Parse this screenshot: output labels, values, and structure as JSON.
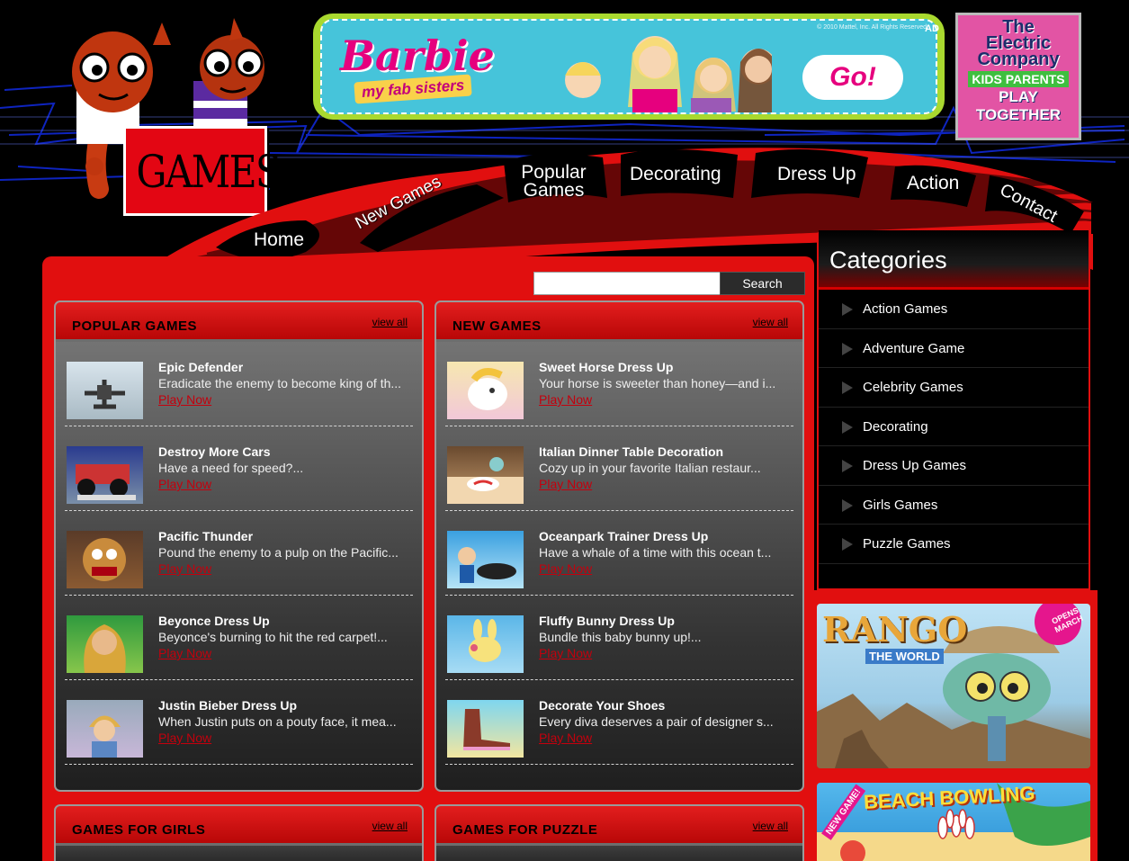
{
  "header": {
    "logo_text": "GAMES",
    "banner_ad": {
      "brand": "Barbie",
      "tagline": "my fab sisters",
      "copyright": "© 2010 Mattel, Inc. All Rights Reserved.",
      "button": "Go!",
      "ad_label": "AD"
    },
    "side_ad": {
      "line1": "The",
      "line2": "Electric",
      "line3": "Company",
      "line4": "KIDS PARENTS",
      "line5": "PLAY",
      "line6": "TOGETHER"
    }
  },
  "nav": {
    "items": [
      {
        "label": "Home"
      },
      {
        "label": "New Games"
      },
      {
        "label": "Popular Games"
      },
      {
        "label": "Decorating"
      },
      {
        "label": "Dress Up"
      },
      {
        "label": "Action"
      },
      {
        "label": "Contact"
      }
    ]
  },
  "search": {
    "button": "Search",
    "placeholder": ""
  },
  "panels": [
    {
      "title": "POPULAR GAMES",
      "view_all": "view all",
      "games": [
        {
          "title": "Epic Defender",
          "desc": "Eradicate the enemy to become king of th...",
          "play": "Play Now"
        },
        {
          "title": "Destroy More Cars",
          "desc": "Have a need for speed?...",
          "play": "Play Now"
        },
        {
          "title": "Pacific Thunder",
          "desc": "Pound the enemy to a pulp on the Pacific...",
          "play": "Play Now"
        },
        {
          "title": "Beyonce Dress Up",
          "desc": "Beyonce's burning to hit the red carpet!...",
          "play": "Play Now"
        },
        {
          "title": "Justin Bieber Dress Up",
          "desc": "When Justin puts on a pouty face, it mea...",
          "play": "Play Now"
        }
      ]
    },
    {
      "title": "NEW GAMES",
      "view_all": "view all",
      "games": [
        {
          "title": "Sweet Horse Dress Up",
          "desc": "Your horse is sweeter than honey—and i...",
          "play": "Play Now"
        },
        {
          "title": "Italian Dinner Table Decoration",
          "desc": "Cozy up in your favorite Italian restaur...",
          "play": "Play Now"
        },
        {
          "title": "Oceanpark Trainer Dress Up",
          "desc": "Have a whale of a time with this ocean t...",
          "play": "Play Now"
        },
        {
          "title": "Fluffy Bunny Dress Up",
          "desc": "Bundle this baby bunny up!...",
          "play": "Play Now"
        },
        {
          "title": "Decorate Your Shoes",
          "desc": "Every diva deserves a pair of designer s...",
          "play": "Play Now"
        }
      ]
    },
    {
      "title": "GAMES FOR GIRLS",
      "view_all": "view all"
    },
    {
      "title": "GAMES FOR PUZZLE",
      "view_all": "view all"
    }
  ],
  "sidebar": {
    "title": "Categories",
    "items": [
      {
        "label": "Action Games"
      },
      {
        "label": "Adventure Game"
      },
      {
        "label": "Celebrity Games"
      },
      {
        "label": "Decorating"
      },
      {
        "label": "Dress Up Games"
      },
      {
        "label": "Girls Games"
      },
      {
        "label": "Puzzle Games"
      }
    ],
    "ads": {
      "rango_title": "RANGO",
      "rango_sub": "THE WORLD",
      "rango_badge": "OPENS MARCH",
      "bowling_title": "BEACH BOWLING",
      "bowling_badge": "NEW GAME!"
    }
  },
  "colors": {
    "accent": "#e10f0f",
    "panel_head": "#d01010",
    "play_link": "#c4000d",
    "background": "#000000"
  }
}
